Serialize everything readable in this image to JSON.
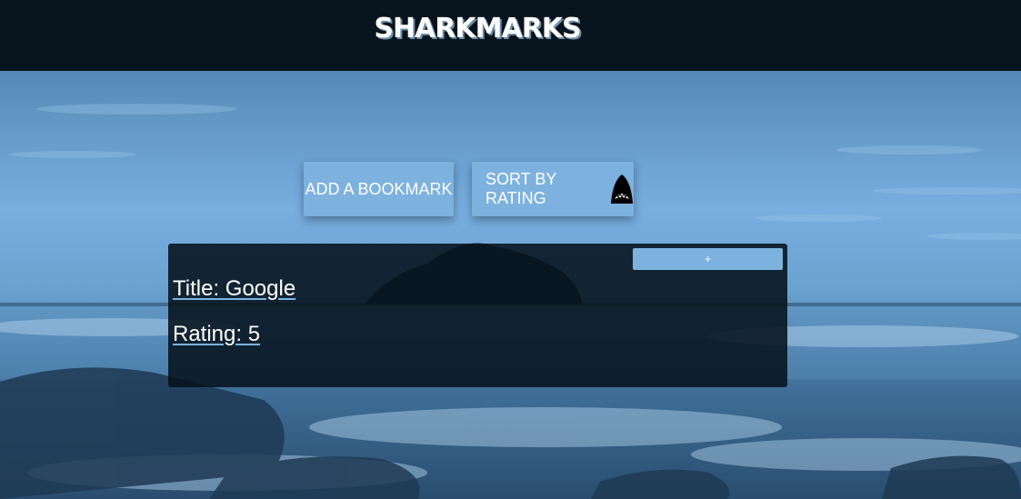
{
  "header": {
    "logo": "SHARKMARKS"
  },
  "toolbar": {
    "add_label": "ADD A BOOKMARK",
    "sort_label": "SORT BY RATING",
    "sort_icon": "shark-jaws-icon"
  },
  "bookmarks": [
    {
      "expand_label": "+",
      "title_text": "Title: Google",
      "rating_text": "Rating: 5"
    }
  ],
  "colors": {
    "header_bg": "#08141d",
    "button_bg": "#7db2de",
    "card_bg": "#06121c"
  }
}
